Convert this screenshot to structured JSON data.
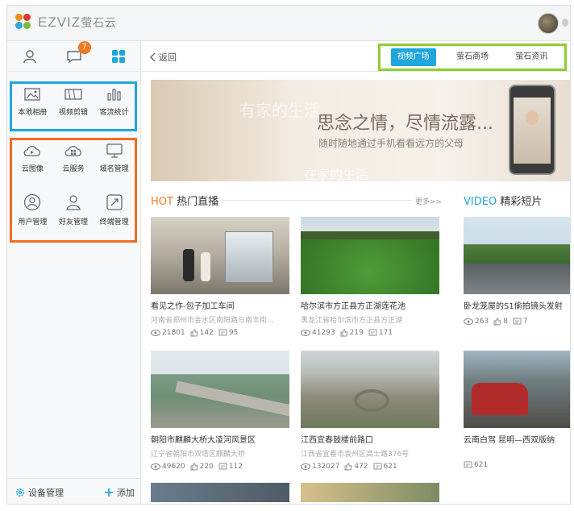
{
  "app": {
    "logo_text": "EZVIZ",
    "logo_cn": "萤石云"
  },
  "sidebar": {
    "tab_badge": "7",
    "blue_group": [
      {
        "label": "本地相册",
        "icon": "image-icon"
      },
      {
        "label": "视频剪辑",
        "icon": "video-edit-icon"
      },
      {
        "label": "客流统计",
        "icon": "bar-chart-icon"
      }
    ],
    "orange_group": [
      {
        "label": "云图像",
        "icon": "cloud-play-icon"
      },
      {
        "label": "云服务",
        "icon": "cloud-grid-icon"
      },
      {
        "label": "域名管理",
        "icon": "monitor-icon"
      },
      {
        "label": "用户管理",
        "icon": "user-icon"
      },
      {
        "label": "好友管理",
        "icon": "friends-icon"
      },
      {
        "label": "终端管理",
        "icon": "terminal-icon"
      }
    ],
    "bottom": {
      "device_label": "设备管理",
      "add_label": "添加"
    }
  },
  "topnav": {
    "back_label": "返回",
    "tabs": [
      "视频广场",
      "萤石商场",
      "萤石资讯"
    ],
    "active_tab": 0
  },
  "banner": {
    "watermark": "有家的生活",
    "title": "思念之情，尽情流露...",
    "subtitle": "随时随地通过手机看看远方的父母",
    "watermark2": "在家的生活"
  },
  "hot": {
    "en": "HOT",
    "cn": "热门直播",
    "more": "更多>>"
  },
  "video": {
    "en": "VIDEO",
    "cn": "精彩短片"
  },
  "cards": [
    {
      "title": "看见之作-包子加工车间",
      "location": "河南省郑州市金水区南阳路与南丰街...",
      "views": "21801",
      "likes": "142",
      "comments": "95"
    },
    {
      "title": "哈尔滨市方正县方正湖莲花池",
      "location": "黑龙江省哈尔滨市方正县方正湖",
      "views": "41293",
      "likes": "219",
      "comments": "171"
    },
    {
      "title": "卧龙笼屋的S1偷拍镜头发射",
      "location": "",
      "views": "263",
      "likes": "8",
      "comments": "7"
    },
    {
      "title": "朝阳市麒麟大桥大凌河风景区",
      "location": "辽宁省朝阳市双塔区麒麟大桥",
      "views": "49620",
      "likes": "220",
      "comments": "112"
    },
    {
      "title": "江西宜春鼓楼前路口",
      "location": "江西省宜春市袁州区高士路376号",
      "views": "132027",
      "likes": "472",
      "comments": "621"
    },
    {
      "title": "云南白驾 昆明—西双版纳",
      "location": "",
      "views": "",
      "likes": "",
      "comments": "621"
    }
  ]
}
